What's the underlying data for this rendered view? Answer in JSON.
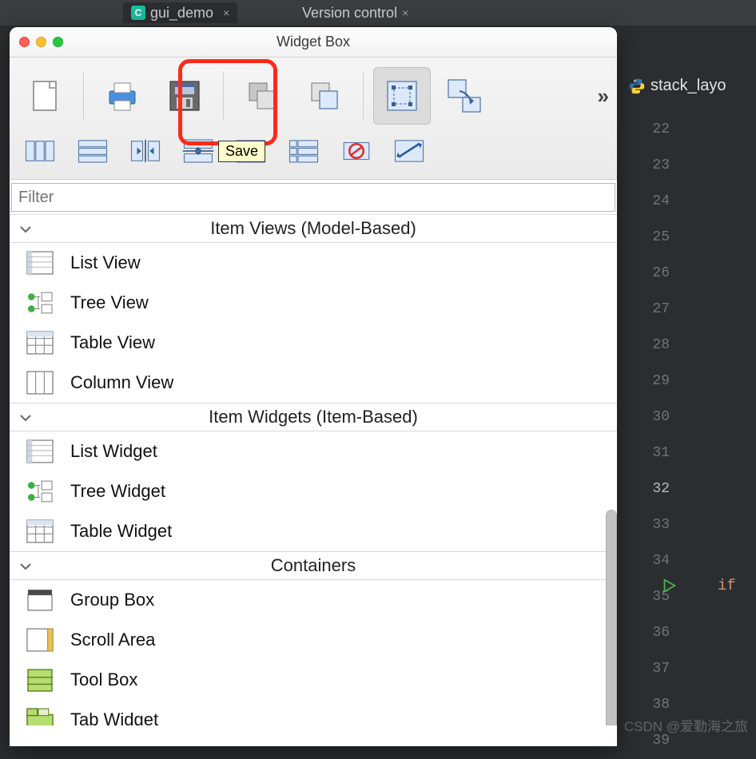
{
  "ide": {
    "tab1_label": "gui_demo",
    "tab1_close": "×",
    "tab2_label": "Version control",
    "tab2_close": "×",
    "open_file": "stack_layo",
    "line_numbers": [
      "22",
      "23",
      "24",
      "25",
      "26",
      "27",
      "28",
      "29",
      "30",
      "31",
      "32",
      "33",
      "34",
      "35",
      "36",
      "37",
      "38",
      "39"
    ],
    "active_line": "32",
    "kw": "if"
  },
  "window": {
    "title": "Widget Box",
    "tooltip_save": "Save",
    "filter_placeholder": "Filter",
    "overflow": "»"
  },
  "toolbar_row1": [
    "new-file",
    "print",
    "save",
    "undo",
    "redo",
    "edit-widgets",
    "edit-signals-slots"
  ],
  "toolbar_row2": [
    "layout-horizontal",
    "layout-vertical",
    "layout-h-splitter",
    "layout-v-splitter",
    "layout-grid",
    "layout-form",
    "break-layout",
    "adjust-size"
  ],
  "sections": [
    {
      "title": "Item Views (Model-Based)",
      "items": [
        {
          "label": "List View",
          "icon": "list-view-icon"
        },
        {
          "label": "Tree View",
          "icon": "tree-view-icon"
        },
        {
          "label": "Table View",
          "icon": "table-view-icon"
        },
        {
          "label": "Column View",
          "icon": "column-view-icon"
        }
      ]
    },
    {
      "title": "Item Widgets (Item-Based)",
      "items": [
        {
          "label": "List Widget",
          "icon": "list-view-icon"
        },
        {
          "label": "Tree Widget",
          "icon": "tree-view-icon"
        },
        {
          "label": "Table Widget",
          "icon": "table-view-icon"
        }
      ]
    },
    {
      "title": "Containers",
      "items": [
        {
          "label": "Group Box",
          "icon": "group-box-icon"
        },
        {
          "label": "Scroll Area",
          "icon": "scroll-area-icon"
        },
        {
          "label": "Tool Box",
          "icon": "tool-box-icon"
        },
        {
          "label": "Tab Widget",
          "icon": "tab-widget-icon"
        }
      ]
    }
  ],
  "watermark": "CSDN @爱勤海之旅"
}
